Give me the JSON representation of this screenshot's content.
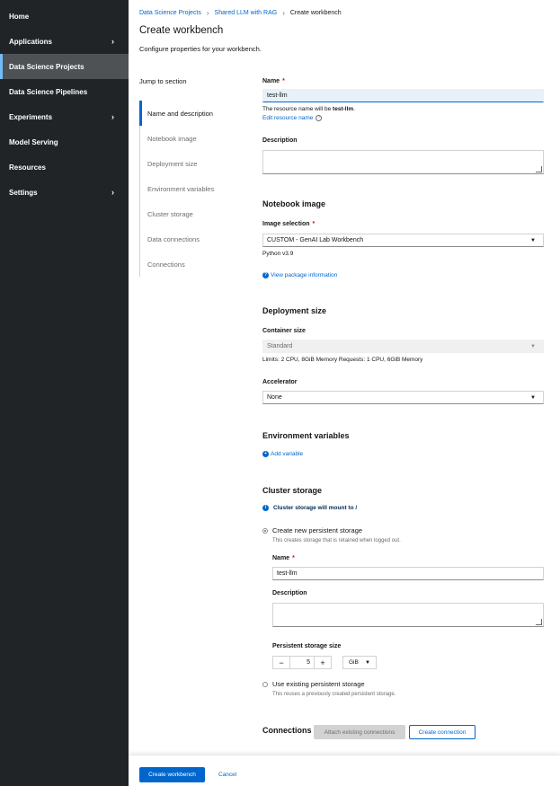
{
  "sidebar": {
    "items": [
      {
        "label": "Home"
      },
      {
        "label": "Applications"
      },
      {
        "label": "Data Science Projects"
      },
      {
        "label": "Data Science Pipelines"
      },
      {
        "label": "Experiments"
      },
      {
        "label": "Model Serving"
      },
      {
        "label": "Resources"
      },
      {
        "label": "Settings"
      }
    ]
  },
  "breadcrumb": {
    "items": [
      "Data Science Projects",
      "Shared LLM with RAG",
      "Create workbench"
    ]
  },
  "page": {
    "title": "Create workbench",
    "subtitle": "Configure properties for your workbench."
  },
  "jump": {
    "title": "Jump to section",
    "items": [
      "Name and description",
      "Notebook image",
      "Deployment size",
      "Environment variables",
      "Cluster storage",
      "Data connections",
      "Connections"
    ]
  },
  "name_section": {
    "name_label": "Name",
    "required_mark": "*",
    "name_value": "test-llm",
    "resource_help_prefix": "The resource name will be ",
    "resource_name": "test-llm",
    "resource_help_suffix": ".",
    "edit_resource_link": "Edit resource name",
    "description_label": "Description"
  },
  "notebook_image": {
    "title": "Notebook image",
    "selection_label": "Image selection",
    "selected": "CUSTOM - GenAI Lab Workbench",
    "python_version": "Python v3.9",
    "view_package_link": "View package information"
  },
  "deployment": {
    "title": "Deployment size",
    "container_label": "Container size",
    "container_value": "Standard",
    "limits_text": "Limits: 2 CPU, 8GiB Memory Requests: 1 CPU, 6GiB Memory",
    "accelerator_label": "Accelerator",
    "accelerator_value": "None"
  },
  "env": {
    "title": "Environment variables",
    "add_link": "Add variable"
  },
  "storage": {
    "title": "Cluster storage",
    "info": "Cluster storage will mount to /",
    "create_new_label": "Create new persistent storage",
    "create_new_help": "This creates storage that is retained when logged out.",
    "name_label": "Name",
    "name_value": "test-llm",
    "description_label": "Description",
    "size_label": "Persistent storage size",
    "size_value": "5",
    "size_unit": "GiB",
    "existing_label": "Use existing persistent storage",
    "existing_help": "This reuses a previously created persistent storage."
  },
  "connections": {
    "title": "Connections",
    "attach_button": "Attach existing connections",
    "create_button": "Create connection"
  },
  "footer": {
    "create_button": "Create workbench",
    "cancel_button": "Cancel"
  },
  "colors": {
    "sidebar_bg": "#212427",
    "active_nav_bg": "#4f5255",
    "primary": "#0066cc"
  }
}
